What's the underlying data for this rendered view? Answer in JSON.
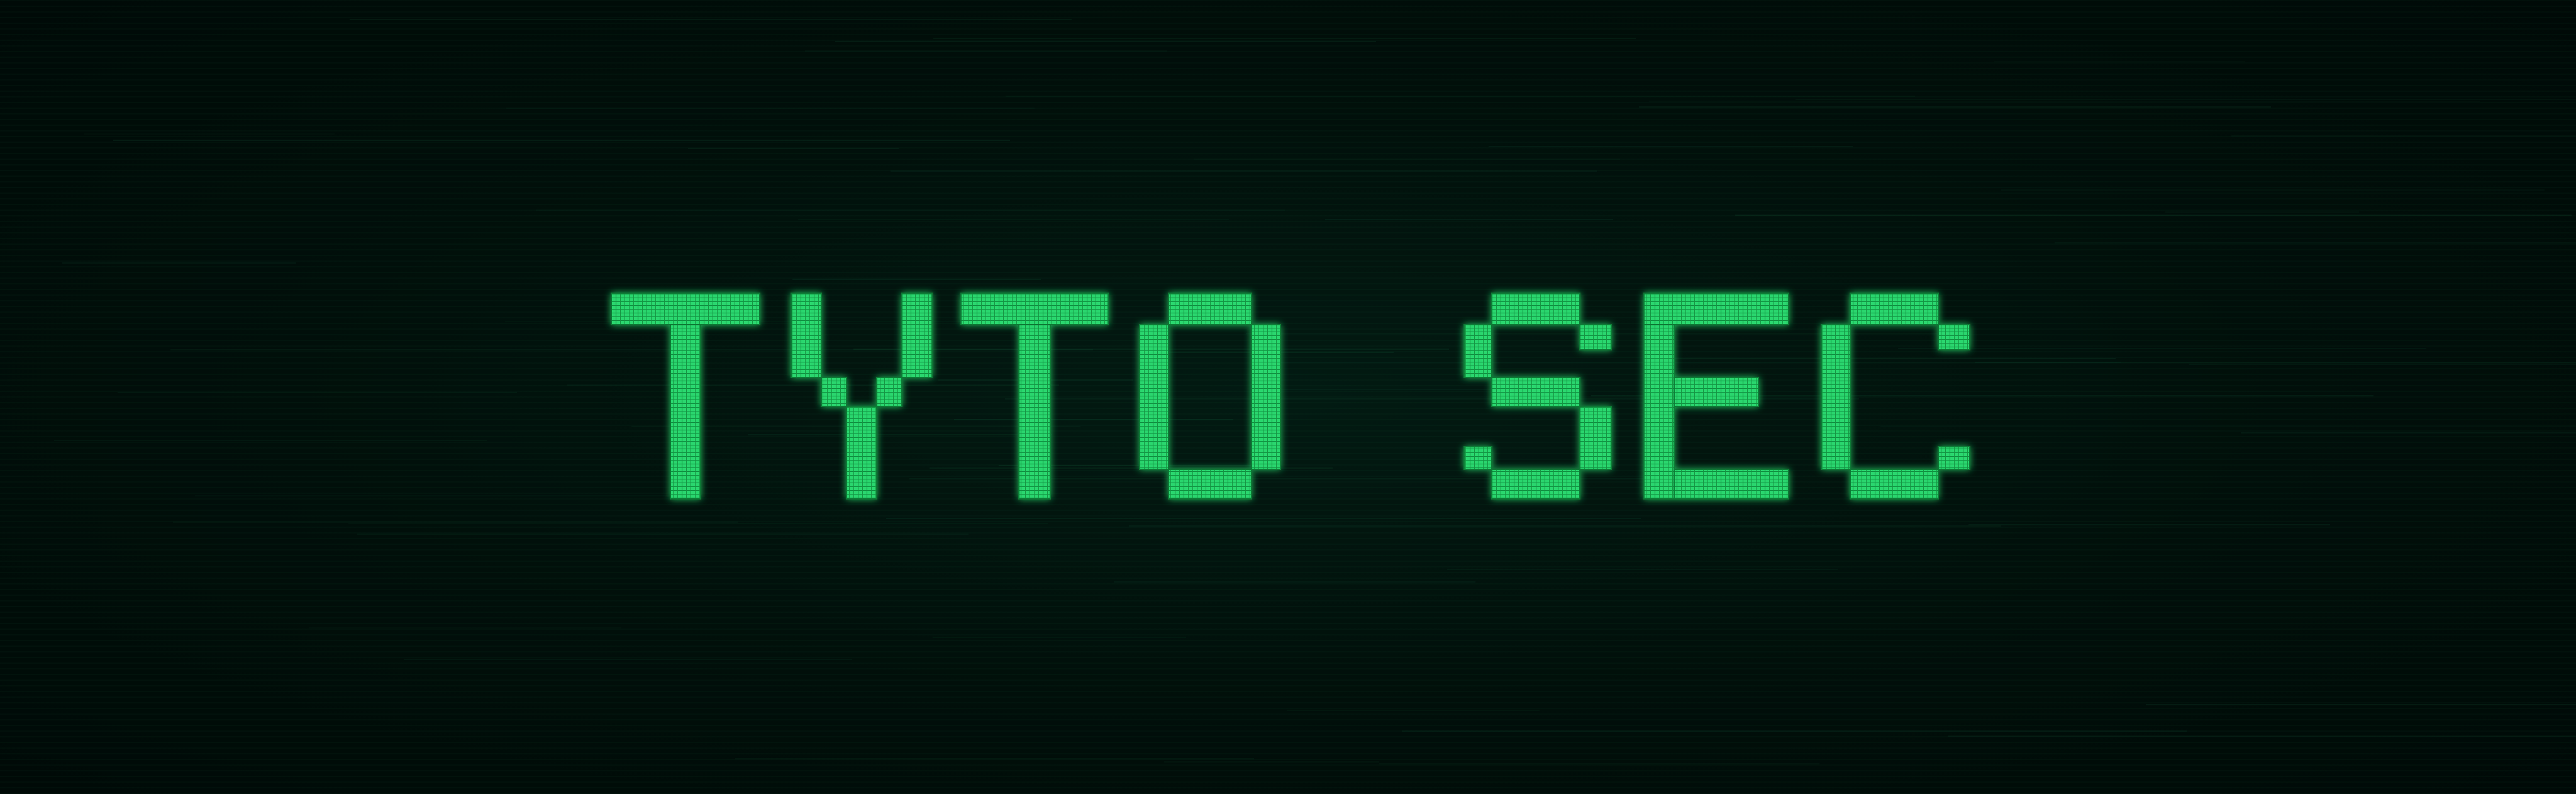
{
  "logo": {
    "text": "TYTO SEC",
    "color": "#27d36a",
    "color_dark": "#0b7a35",
    "background": "#000f0a"
  }
}
